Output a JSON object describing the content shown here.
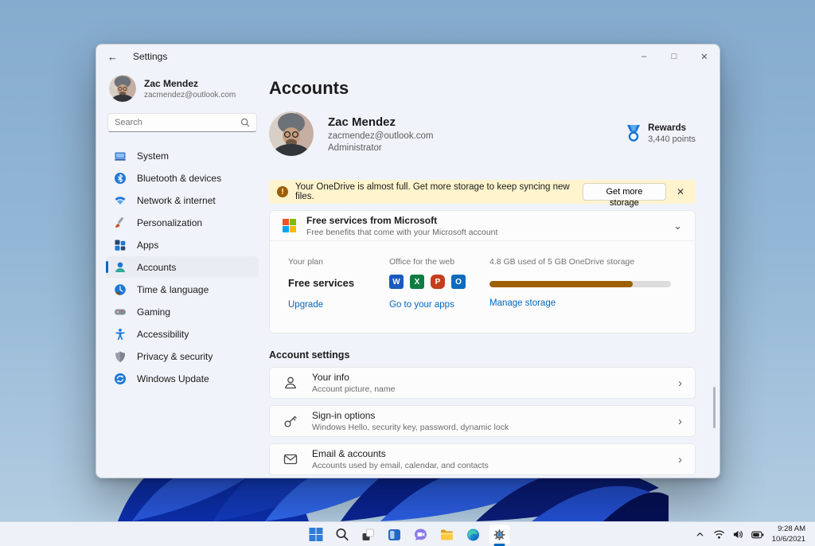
{
  "icons": {
    "back": "←",
    "minimize": "–",
    "maximize": "□",
    "close": "✕",
    "chevron_down": "⌄",
    "chevron_right": "›",
    "banner_close": "✕",
    "warning_mark": "!"
  },
  "titlebar": {
    "title": "Settings"
  },
  "sidebar": {
    "user": {
      "name": "Zac Mendez",
      "email": "zacmendez@outlook.com"
    },
    "search": {
      "placeholder": "Search"
    },
    "items": [
      {
        "label": "System"
      },
      {
        "label": "Bluetooth & devices"
      },
      {
        "label": "Network & internet"
      },
      {
        "label": "Personalization"
      },
      {
        "label": "Apps"
      },
      {
        "label": "Accounts"
      },
      {
        "label": "Time & language"
      },
      {
        "label": "Gaming"
      },
      {
        "label": "Accessibility"
      },
      {
        "label": "Privacy & security"
      },
      {
        "label": "Windows Update"
      }
    ],
    "selected": "Accounts"
  },
  "main": {
    "title": "Accounts",
    "profile": {
      "name": "Zac Mendez",
      "email": "zacmendez@outlook.com",
      "role": "Administrator"
    },
    "rewards": {
      "label": "Rewards",
      "points": "3,440 points"
    },
    "banner": {
      "message": "Your OneDrive is almost full. Get more storage to keep syncing new files.",
      "button": "Get more storage"
    },
    "free_services": {
      "title": "Free services from Microsoft",
      "subtitle": "Free benefits that come with your Microsoft account",
      "plan": {
        "label": "Your plan",
        "value": "Free services",
        "link": "Upgrade"
      },
      "office": {
        "label": "Office for the web",
        "link": "Go to your apps",
        "apps": [
          {
            "name": "Word",
            "letter": "W",
            "color": "#185abd"
          },
          {
            "name": "Excel",
            "letter": "X",
            "color": "#107c41"
          },
          {
            "name": "PowerPoint",
            "letter": "P",
            "color": "#c43e1c"
          },
          {
            "name": "Outlook",
            "letter": "O",
            "color": "#0f6cbd"
          }
        ]
      },
      "storage": {
        "label": "4.8 GB used of 5 GB OneDrive storage",
        "link": "Manage storage",
        "progress_percent": 79
      }
    },
    "account_settings": {
      "heading": "Account settings",
      "rows": [
        {
          "title": "Your info",
          "subtitle": "Account picture, name"
        },
        {
          "title": "Sign-in options",
          "subtitle": "Windows Hello, security key, password, dynamic lock"
        },
        {
          "title": "Email & accounts",
          "subtitle": "Accounts used by email, calendar, and contacts"
        }
      ]
    }
  },
  "taskbar": {
    "apps": [
      "start",
      "search",
      "task-view",
      "widgets",
      "chat",
      "file-explorer",
      "edge",
      "settings"
    ],
    "active_app": "settings",
    "tray": {
      "time": "9:28 AM",
      "date": "10/6/2021"
    }
  },
  "colors": {
    "accent": "#0067c0",
    "link": "#0067c0",
    "banner_bg": "#fff4ce",
    "warning": "#9d5d00",
    "progress_fill": "#9d6000",
    "selection_bg": "#e9edf3",
    "ms_logo": [
      "#f25022",
      "#7fba00",
      "#00a4ef",
      "#ffb900"
    ]
  }
}
